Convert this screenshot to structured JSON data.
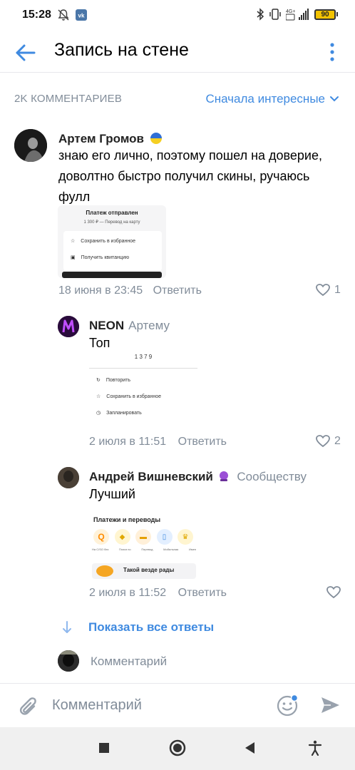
{
  "status": {
    "time": "15:28",
    "network": "4G+",
    "battery": "90"
  },
  "header": {
    "title": "Запись на стене"
  },
  "comments_bar": {
    "count": "2K КОММЕНТАРИЕВ",
    "sort": "Сначала интересные"
  },
  "comments": [
    {
      "author": "Артем Громов",
      "text_lines": [
        "знаю его лично, поэтому пошел на доверие,",
        "доволтно быстро получил скины, ручаюсь",
        "фулл"
      ],
      "time": "18 июня в 23:45",
      "reply": "Ответить",
      "likes": "1",
      "attachment": {
        "title": "Платеж отправлен",
        "subtitle": "1 300 ₽ — Перевод на карту",
        "rows": [
          "Сохранить в избранное",
          "Получить квитанцию"
        ]
      }
    },
    {
      "author": "NEON",
      "target": "Артему",
      "text": "Топ",
      "time": "2 июля в 11:51",
      "reply": "Ответить",
      "likes": "2",
      "attachment": {
        "rows": [
          "Повторить",
          "Сохранить в избранное",
          "Запланировать"
        ]
      }
    },
    {
      "author": "Андрей Вишневский",
      "target": "Сообществу",
      "text": "Лучший",
      "time": "2 июля в 11:52",
      "reply": "Ответить",
      "likes": "",
      "attachment": {
        "title": "Платежи и переводы",
        "items": [
          "На C/SO без",
          "Плаги по",
          "Перевод",
          "Мобильная",
          "Имен"
        ],
        "banner": "Такой везде рады"
      }
    }
  ],
  "show_all": "Показать все ответы",
  "inline_comment_placeholder": "Комментарий",
  "composer": {
    "placeholder": "Комментарий"
  },
  "colors": {
    "accent": "#3f8ae0",
    "meta": "#818c99"
  }
}
